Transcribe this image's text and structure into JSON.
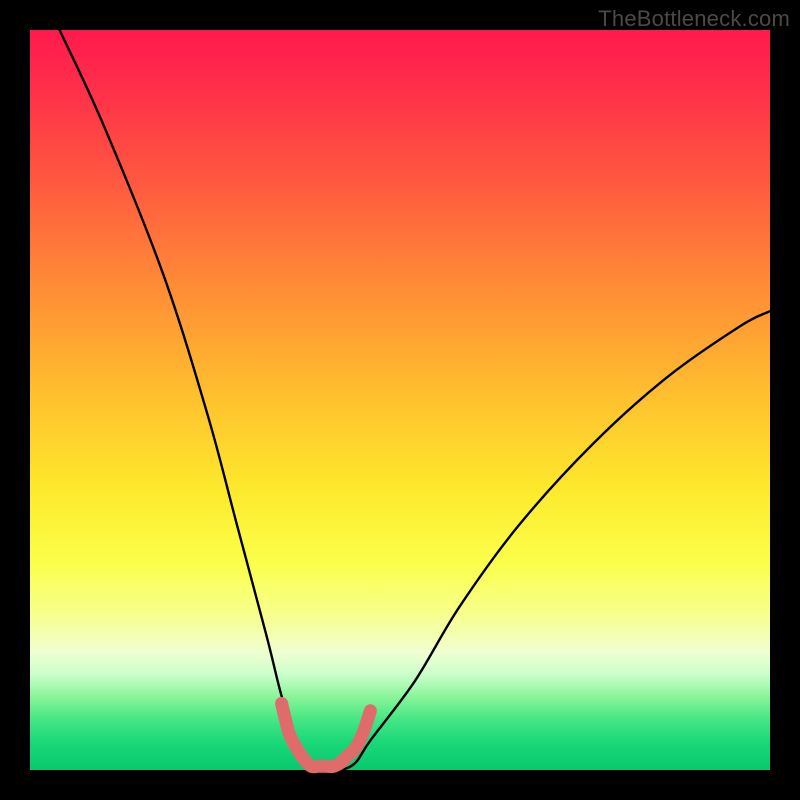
{
  "watermark": "TheBottleneck.com",
  "chart_data": {
    "type": "line",
    "title": "",
    "xlabel": "",
    "ylabel": "",
    "xlim": [
      0,
      100
    ],
    "ylim": [
      0,
      100
    ],
    "series": [
      {
        "name": "bottleneck-curve",
        "x": [
          4,
          10,
          18,
          24,
          28,
          32,
          34,
          36,
          38,
          40,
          42,
          44,
          46,
          52,
          58,
          66,
          76,
          86,
          96,
          100
        ],
        "y": [
          100,
          87,
          67,
          48,
          33,
          18,
          10,
          4,
          1,
          0,
          0,
          1,
          4,
          12,
          22,
          33,
          44,
          53,
          60,
          62
        ]
      }
    ],
    "annotations": [
      {
        "name": "valley-marker",
        "color": "#e06b6b",
        "x": [
          34,
          35,
          36,
          37,
          38,
          39,
          40,
          41,
          42,
          43,
          44,
          45,
          46
        ],
        "y": [
          9,
          5,
          3,
          1.5,
          0.5,
          0.5,
          0.5,
          0.5,
          1,
          2,
          3,
          5,
          8
        ]
      }
    ],
    "background_gradient": {
      "top": "#ff1a4d",
      "mid": "#fde92c",
      "bottom": "#08c86e"
    }
  }
}
